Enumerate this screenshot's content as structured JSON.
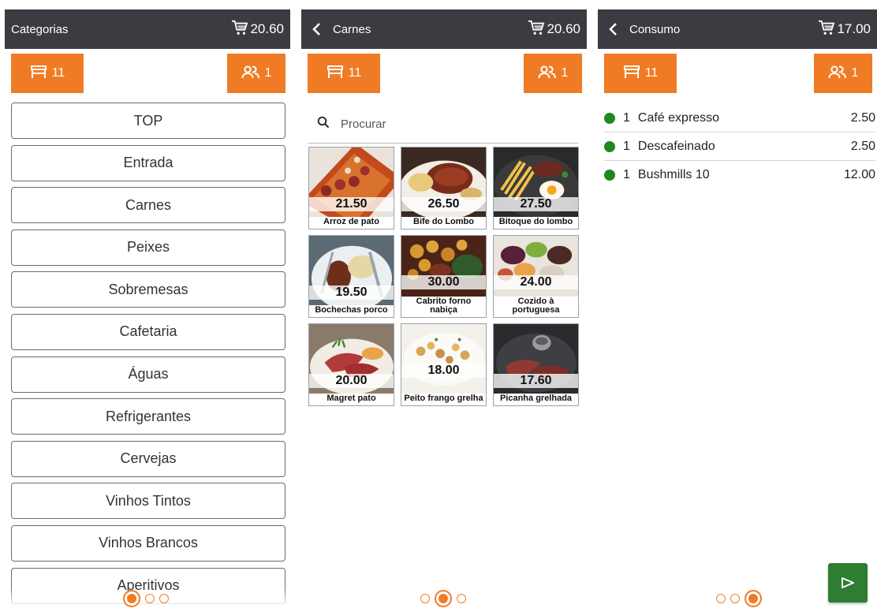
{
  "screens": {
    "categories": {
      "title": "Categorias",
      "cart_total": "20.60",
      "table_number": "11",
      "pax_count": "1",
      "items": [
        "TOP",
        "Entrada",
        "Carnes",
        "Peixes",
        "Sobremesas",
        "Cafetaria",
        "Águas",
        "Refrigerantes",
        "Cervejas",
        "Vinhos Tintos",
        "Vinhos Brancos",
        "Aperitivos"
      ],
      "page": 1
    },
    "products": {
      "title": "Carnes",
      "cart_total": "20.60",
      "table_number": "11",
      "pax_count": "1",
      "search_placeholder": "Procurar",
      "items": [
        {
          "price": "21.50",
          "name": "Arroz de pato"
        },
        {
          "price": "26.50",
          "name": "Bife do Lombo"
        },
        {
          "price": "27.50",
          "name": "Bitoque do lombo"
        },
        {
          "price": "19.50",
          "name": "Bochechas porco"
        },
        {
          "price": "30.00",
          "name": "Cabrito forno nabiça"
        },
        {
          "price": "24.00",
          "name": "Cozido à portuguesa"
        },
        {
          "price": "20.00",
          "name": "Magret pato"
        },
        {
          "price": "18.00",
          "name": "Peito frango grelha"
        },
        {
          "price": "17.60",
          "name": "Picanha grelhada"
        }
      ],
      "page": 2
    },
    "consumption": {
      "title": "Consumo",
      "cart_total": "17.00",
      "table_number": "11",
      "pax_count": "1",
      "items": [
        {
          "qty": "1",
          "name": "Café expresso",
          "value": "2.50"
        },
        {
          "qty": "1",
          "name": "Descafeinado",
          "value": "2.50"
        },
        {
          "qty": "1",
          "name": "Bushmills 10",
          "value": "12.00"
        }
      ],
      "page": 3
    }
  },
  "colors": {
    "accent": "#f07b25",
    "appbar": "#3a3c42",
    "status_dot": "#1e8a1e",
    "send_button": "#2e7d32"
  },
  "icons": {
    "cart": "cart-icon",
    "table": "table-icon",
    "pax": "people-icon",
    "back": "chevron-left-icon",
    "search": "search-icon",
    "send": "send-icon"
  }
}
